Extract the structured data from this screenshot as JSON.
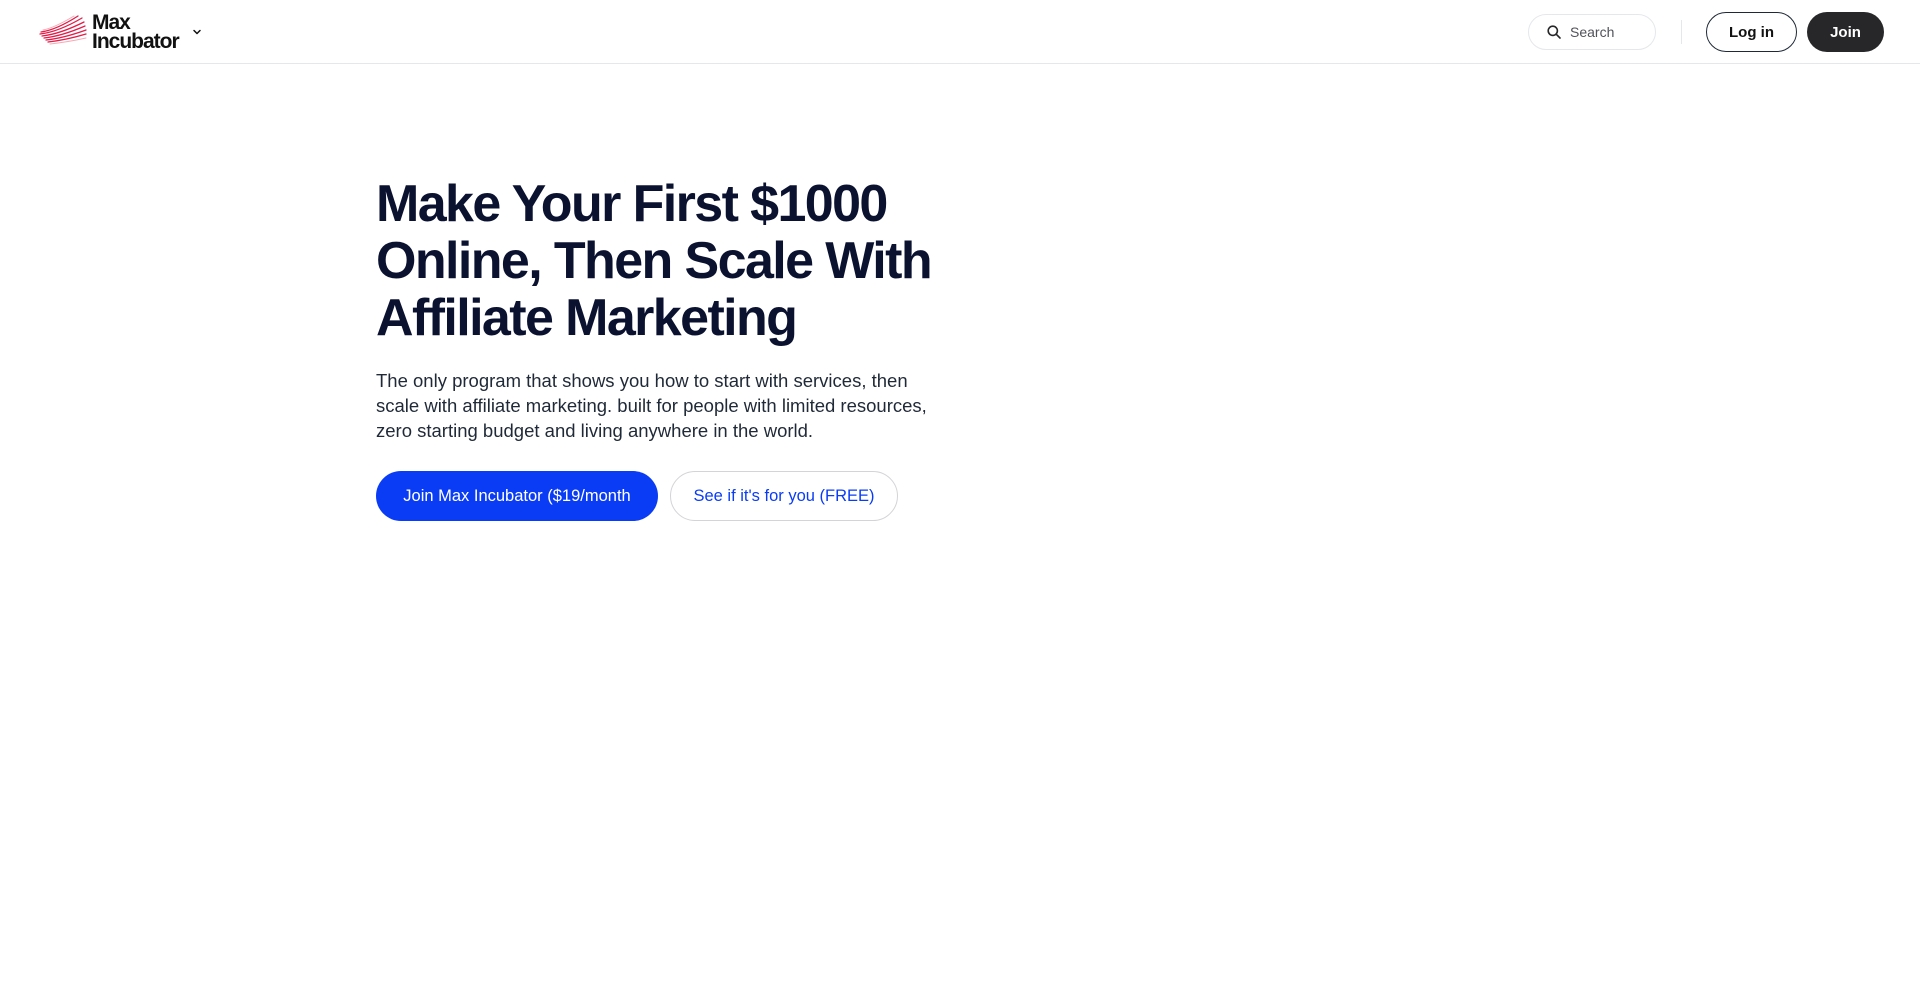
{
  "header": {
    "brand_line1": "Max",
    "brand_line2": "Incubator",
    "search_label": "Search",
    "login_label": "Log in",
    "join_label": "Join"
  },
  "hero": {
    "title": "Make Your First $1000 Online, Then Scale With Affiliate Marketing",
    "description": "The only program that shows you how to start with services, then scale with affiliate marketing. built for people with limited resources, zero starting budget and living anywhere in the world.",
    "primary_cta": "Join Max Incubator ($19/month",
    "secondary_cta": "See if it's for you (FREE)"
  },
  "icons": {
    "logo": "brand-logo-red-swoosh",
    "brand_menu": "chevron-down-icon",
    "search": "search-icon"
  },
  "colors": {
    "accent_blue": "#0a3cf5",
    "join_dark": "#27272a",
    "logo_red": "#e11d48",
    "title": "#0b1230"
  }
}
